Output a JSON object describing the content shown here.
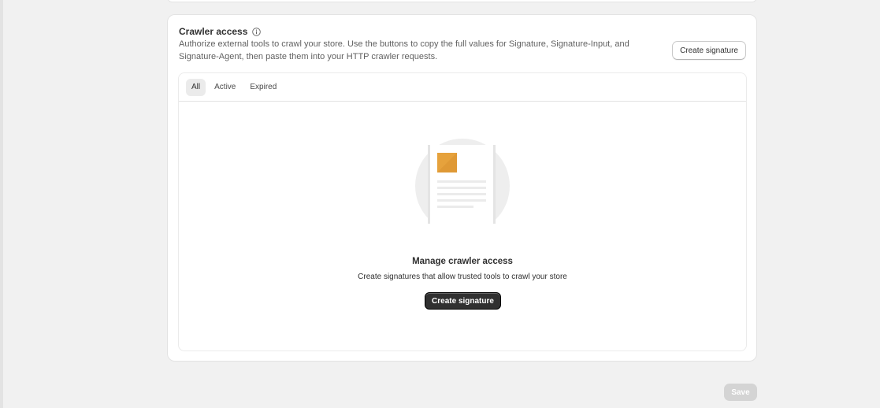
{
  "card": {
    "title": "Crawler access",
    "description": "Authorize external tools to crawl your store. Use the buttons to copy the full values for Signature, Signature-Input, and Signature-Agent, then paste them into your HTTP crawler requests.",
    "header_button": "Create signature"
  },
  "tabs": [
    {
      "label": "All",
      "selected": true
    },
    {
      "label": "Active",
      "selected": false
    },
    {
      "label": "Expired",
      "selected": false
    }
  ],
  "empty_state": {
    "illustration_icon": "document-icon",
    "title": "Manage crawler access",
    "description": "Create signatures that allow trusted tools to crawl your store",
    "button": "Create signature"
  },
  "footer": {
    "save_label": "Save",
    "save_disabled": true
  },
  "colors": {
    "page_background": "#f1f1f1",
    "primary_button": "#303030",
    "illustration_accent": "#e6a23c",
    "disabled_button": "#d4d4d4"
  }
}
